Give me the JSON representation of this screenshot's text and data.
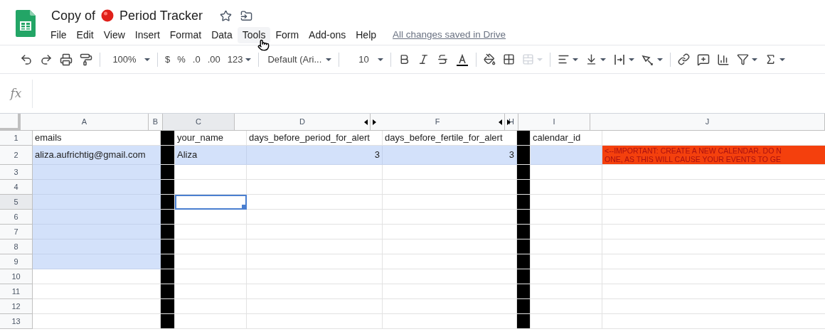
{
  "document": {
    "title_before": "Copy of",
    "title_after": "Period Tracker",
    "starred": false
  },
  "menu": [
    {
      "label": "File",
      "hovered": false
    },
    {
      "label": "Edit",
      "hovered": false
    },
    {
      "label": "View",
      "hovered": false
    },
    {
      "label": "Insert",
      "hovered": false
    },
    {
      "label": "Format",
      "hovered": false
    },
    {
      "label": "Data",
      "hovered": false
    },
    {
      "label": "Tools",
      "hovered": true
    },
    {
      "label": "Form",
      "hovered": false
    },
    {
      "label": "Add-ons",
      "hovered": false
    },
    {
      "label": "Help",
      "hovered": false
    }
  ],
  "save_status": "All changes saved in Drive",
  "toolbar": {
    "zoom": "100%",
    "currency": "$",
    "percent": "%",
    "decimal_less": ".0",
    "decimal_more": ".00",
    "number_format": "123",
    "font": "Default (Ari...",
    "font_size": "10",
    "merge_disabled": true
  },
  "formula_bar": {
    "label": "fx"
  },
  "columns": [
    {
      "label": "A",
      "highlighted": false,
      "hidden_left": false,
      "hidden_right": false
    },
    {
      "label": "B",
      "highlighted": false,
      "hidden_left": false,
      "hidden_right": false,
      "color": "#000000"
    },
    {
      "label": "C",
      "highlighted": true,
      "hidden_left": false,
      "hidden_right": false
    },
    {
      "label": "D",
      "highlighted": false,
      "hidden_left": false,
      "hidden_right": true
    },
    {
      "label": "F",
      "highlighted": false,
      "hidden_left": true,
      "hidden_right": true
    },
    {
      "label": "H",
      "highlighted": false,
      "hidden_left": true,
      "hidden_right": false,
      "color": "#000000"
    },
    {
      "label": "I",
      "highlighted": false,
      "hidden_left": false,
      "hidden_right": false
    },
    {
      "label": "J",
      "highlighted": false,
      "hidden_left": false,
      "hidden_right": false
    }
  ],
  "rows": [
    {
      "number": "1",
      "highlighted": false,
      "cells": [
        {
          "text": "emails",
          "selected": false,
          "active": false
        },
        {
          "selected": false,
          "active": false
        },
        {
          "text": "your_name",
          "selected": false,
          "active": false
        },
        {
          "text": "days_before_period_for_alert",
          "selected": false,
          "active": false
        },
        {
          "text": "days_before_fertile_for_alert",
          "selected": false,
          "active": false
        },
        {
          "selected": false,
          "active": false
        },
        {
          "text": "calendar_id",
          "selected": false,
          "active": false
        },
        {
          "selected": false,
          "active": false
        }
      ]
    },
    {
      "number": "2",
      "highlighted": false,
      "cells": [
        {
          "text": "aliza.aufrichtig@gmail.com",
          "selected": true,
          "active": false
        },
        {
          "selected": false,
          "active": false
        },
        {
          "text": "Aliza",
          "selected": true,
          "active": false
        },
        {
          "text": "3",
          "kind": "number",
          "selected": true,
          "active": false
        },
        {
          "text": "3",
          "kind": "number",
          "selected": true,
          "active": false
        },
        {
          "selected": false,
          "active": false
        },
        {
          "selected": true,
          "active": false
        },
        {
          "lines": [
            "<--IMPORTANT: CREATE A NEW CALENDAR. DO N",
            "ONE, AS THIS WILL CAUSE YOUR EVENTS TO GE"
          ],
          "selected": false,
          "active": false,
          "color": "#f4400d"
        }
      ]
    },
    {
      "number": "3",
      "highlighted": false,
      "cells": [
        {
          "selected": true,
          "active": false
        },
        {
          "selected": false,
          "active": false
        },
        {
          "selected": false,
          "active": false
        },
        {
          "selected": false,
          "active": false
        },
        {
          "selected": false,
          "active": false
        },
        {
          "selected": false,
          "active": false
        },
        {
          "selected": false,
          "active": false
        },
        {
          "selected": false,
          "active": false
        }
      ]
    },
    {
      "number": "4",
      "highlighted": false,
      "cells": [
        {
          "selected": true,
          "active": false
        },
        {
          "selected": false,
          "active": false
        },
        {
          "selected": false,
          "active": false
        },
        {
          "selected": false,
          "active": false
        },
        {
          "selected": false,
          "active": false
        },
        {
          "selected": false,
          "active": false
        },
        {
          "selected": false,
          "active": false
        },
        {
          "selected": false,
          "active": false
        }
      ]
    },
    {
      "number": "5",
      "highlighted": true,
      "cells": [
        {
          "selected": true,
          "active": false
        },
        {
          "selected": false,
          "active": false
        },
        {
          "selected": false,
          "active": true
        },
        {
          "selected": false,
          "active": false
        },
        {
          "selected": false,
          "active": false
        },
        {
          "selected": false,
          "active": false
        },
        {
          "selected": false,
          "active": false
        },
        {
          "selected": false,
          "active": false
        }
      ]
    },
    {
      "number": "6",
      "highlighted": false,
      "cells": [
        {
          "selected": true,
          "active": false
        },
        {
          "selected": false,
          "active": false
        },
        {
          "selected": false,
          "active": false
        },
        {
          "selected": false,
          "active": false
        },
        {
          "selected": false,
          "active": false
        },
        {
          "selected": false,
          "active": false
        },
        {
          "selected": false,
          "active": false
        },
        {
          "selected": false,
          "active": false
        }
      ]
    },
    {
      "number": "7",
      "highlighted": false,
      "cells": [
        {
          "selected": true,
          "active": false
        },
        {
          "selected": false,
          "active": false
        },
        {
          "selected": false,
          "active": false
        },
        {
          "selected": false,
          "active": false
        },
        {
          "selected": false,
          "active": false
        },
        {
          "selected": false,
          "active": false
        },
        {
          "selected": false,
          "active": false
        },
        {
          "selected": false,
          "active": false
        }
      ]
    },
    {
      "number": "8",
      "highlighted": false,
      "cells": [
        {
          "selected": true,
          "active": false
        },
        {
          "selected": false,
          "active": false
        },
        {
          "selected": false,
          "active": false
        },
        {
          "selected": false,
          "active": false
        },
        {
          "selected": false,
          "active": false
        },
        {
          "selected": false,
          "active": false
        },
        {
          "selected": false,
          "active": false
        },
        {
          "selected": false,
          "active": false
        }
      ]
    },
    {
      "number": "9",
      "highlighted": false,
      "cells": [
        {
          "selected": true,
          "active": false
        },
        {
          "selected": false,
          "active": false
        },
        {
          "selected": false,
          "active": false
        },
        {
          "selected": false,
          "active": false
        },
        {
          "selected": false,
          "active": false
        },
        {
          "selected": false,
          "active": false
        },
        {
          "selected": false,
          "active": false
        },
        {
          "selected": false,
          "active": false
        }
      ]
    },
    {
      "number": "10",
      "highlighted": false,
      "cells": [
        {
          "selected": false,
          "active": false
        },
        {
          "selected": false,
          "active": false
        },
        {
          "selected": false,
          "active": false
        },
        {
          "selected": false,
          "active": false
        },
        {
          "selected": false,
          "active": false
        },
        {
          "selected": false,
          "active": false
        },
        {
          "selected": false,
          "active": false
        },
        {
          "selected": false,
          "active": false
        }
      ]
    },
    {
      "number": "11",
      "highlighted": false,
      "cells": [
        {
          "selected": false,
          "active": false
        },
        {
          "selected": false,
          "active": false
        },
        {
          "selected": false,
          "active": false
        },
        {
          "selected": false,
          "active": false
        },
        {
          "selected": false,
          "active": false
        },
        {
          "selected": false,
          "active": false
        },
        {
          "selected": false,
          "active": false
        },
        {
          "selected": false,
          "active": false
        }
      ]
    },
    {
      "number": "12",
      "highlighted": false,
      "cells": [
        {
          "selected": false,
          "active": false
        },
        {
          "selected": false,
          "active": false
        },
        {
          "selected": false,
          "active": false
        },
        {
          "selected": false,
          "active": false
        },
        {
          "selected": false,
          "active": false
        },
        {
          "selected": false,
          "active": false
        },
        {
          "selected": false,
          "active": false
        },
        {
          "selected": false,
          "active": false
        }
      ]
    },
    {
      "number": "13",
      "highlighted": false,
      "cells": [
        {
          "selected": false,
          "active": false
        },
        {
          "selected": false,
          "active": false
        },
        {
          "selected": false,
          "active": false
        },
        {
          "selected": false,
          "active": false
        },
        {
          "selected": false,
          "active": false
        },
        {
          "selected": false,
          "active": false
        },
        {
          "selected": false,
          "active": false
        },
        {
          "selected": false,
          "active": false
        }
      ]
    }
  ]
}
